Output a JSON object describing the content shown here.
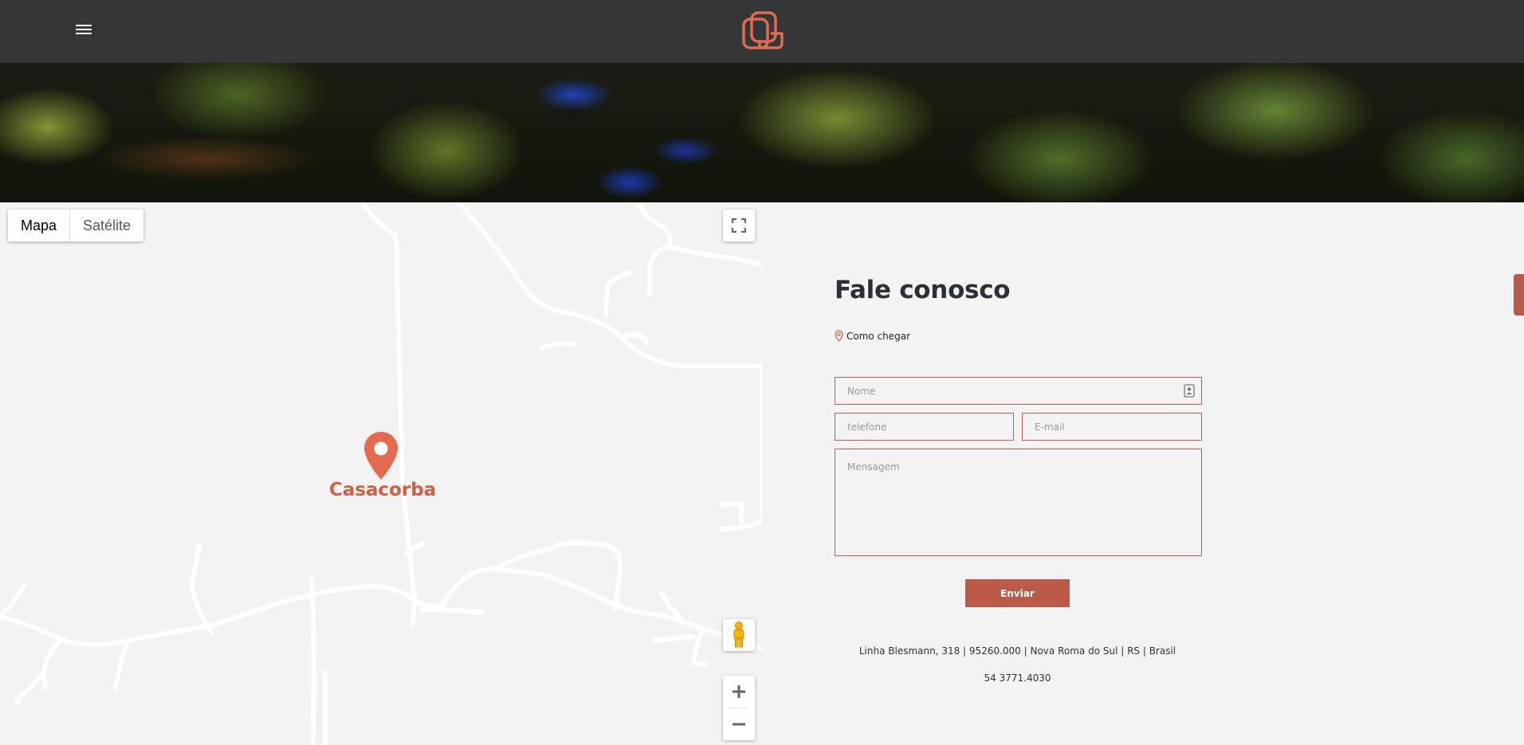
{
  "header": {
    "menu_icon": "hamburger-menu-icon",
    "logo_icon": "casacorba-logo-icon",
    "accent_color": "#e06a52",
    "background_color": "#343638"
  },
  "hero": {
    "image_description_icon": "vineyard-banner-image"
  },
  "map": {
    "map_types": [
      "Mapa",
      "Satélite"
    ],
    "selected_map_type": "Mapa",
    "marker_label": "Casacorba",
    "marker_color": "#e66a50",
    "controls": {
      "fullscreen_icon": "fullscreen-icon",
      "pegman_icon": "street-view-pegman-icon",
      "zoom_in_icon": "plus-icon",
      "zoom_out_icon": "minus-icon"
    }
  },
  "contact": {
    "title": "Fale conosco",
    "directions_label": "Como chegar",
    "form": {
      "name_placeholder": "Nome",
      "phone_placeholder": "telefone",
      "email_placeholder": "E-mail",
      "message_placeholder": "Mensagem",
      "submit_label": "Enviar"
    },
    "address": "Linha Blesmann, 318 | 95260.000 | Nova Roma do Sul | RS | Brasil",
    "phone": "54 3771.4030",
    "border_color": "#c0604c",
    "button_color": "#bb5a48"
  }
}
